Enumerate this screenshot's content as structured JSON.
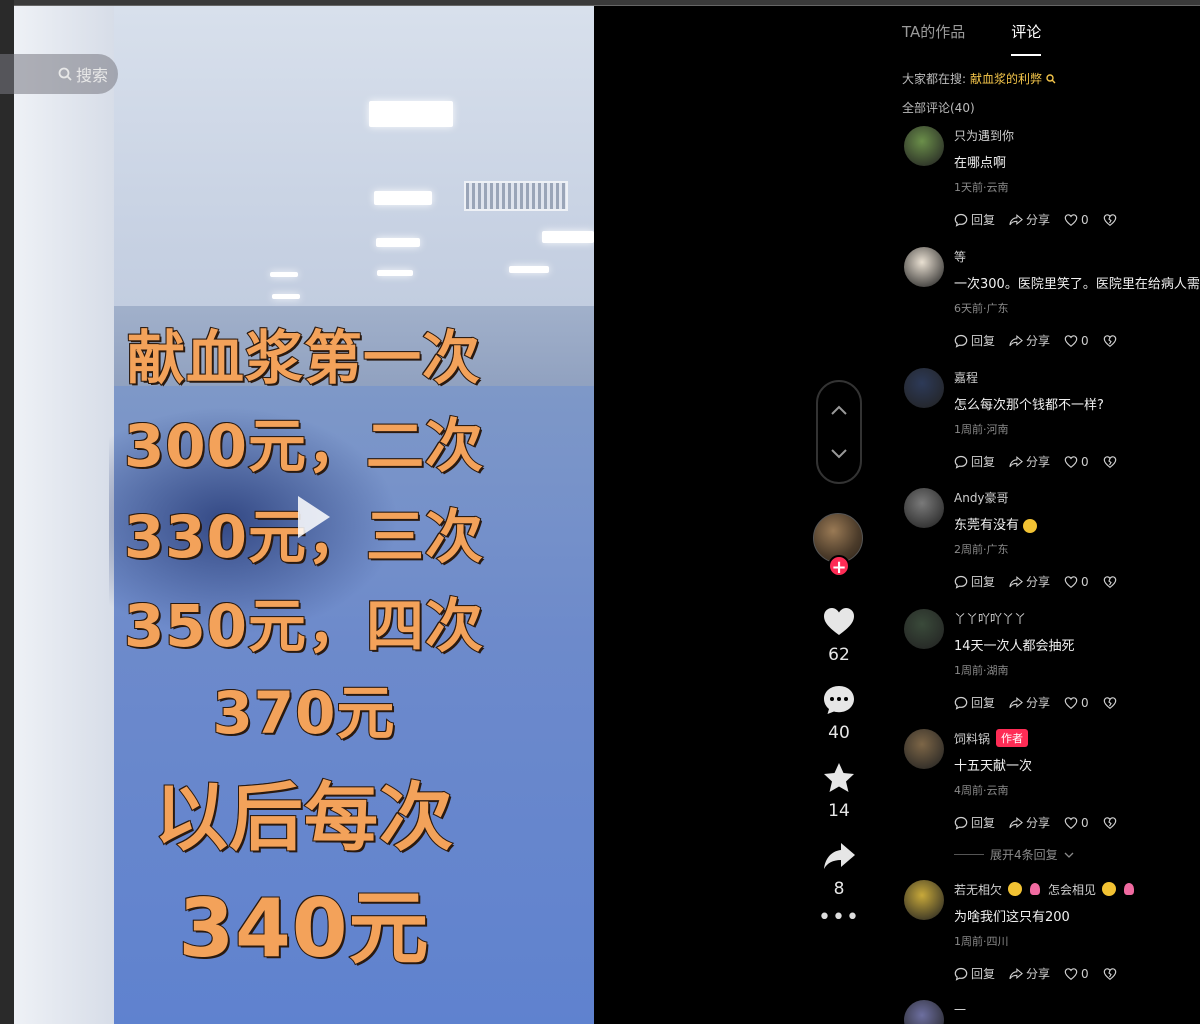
{
  "search": {
    "label": "搜索"
  },
  "video": {
    "overlay": {
      "line1": "献血浆第一次",
      "line2": "300元，二次",
      "line3": "330元，三次",
      "line4": "350元，四次",
      "line5": "370元",
      "line6": "以后每次",
      "line7": "340元"
    }
  },
  "actions": {
    "likes": "62",
    "comments": "40",
    "favorites": "14",
    "shares": "8",
    "follow_symbol": "+",
    "more_symbol": "•••"
  },
  "panel": {
    "tabs": [
      {
        "label": "TA的作品"
      },
      {
        "label": "评论"
      }
    ],
    "search_hint_label": "大家都在搜:",
    "search_hint_keyword": "献血浆的利弊",
    "all_comments": "全部评论(40)",
    "action_labels": {
      "reply": "回复",
      "share": "分享"
    },
    "author_tag": "作者",
    "expand_replies": "展开4条回复",
    "comments": [
      {
        "user": "只为遇到你",
        "text": "在哪点啊",
        "meta": "1天前·云南",
        "likes": "0",
        "avatar_color": "#6b8f4a"
      },
      {
        "user": "等",
        "text": "一次300。医院里笑了。医院里在给病人需要",
        "meta": "6天前·广东",
        "likes": "0",
        "avatar_color": "#e9e0d2"
      },
      {
        "user": "嘉程",
        "text": "怎么每次那个钱都不一样?",
        "meta": "1周前·河南",
        "likes": "0",
        "avatar_color": "#2d3a58"
      },
      {
        "user": "Andy豪哥",
        "text": "东莞有没有",
        "meta": "2周前·广东",
        "likes": "0",
        "avatar_color": "#7a7a7a"
      },
      {
        "user": "丫丫吖吖丫丫",
        "text": "14天一次人都会抽死",
        "meta": "1周前·湖南",
        "likes": "0",
        "avatar_color": "#3a4a3a"
      },
      {
        "user": "饲料锅",
        "text": "十五天献一次",
        "meta": "4周前·云南",
        "likes": "0",
        "avatar_color": "#7d6647"
      },
      {
        "user": "若无相欠",
        "user_suffix": "怎会相见",
        "text": "为啥我们这只有200",
        "meta": "1周前·四川",
        "likes": "0",
        "avatar_color": "#c8a93a"
      },
      {
        "user": "一",
        "avatar_color": "#6d6fa0"
      }
    ]
  }
}
